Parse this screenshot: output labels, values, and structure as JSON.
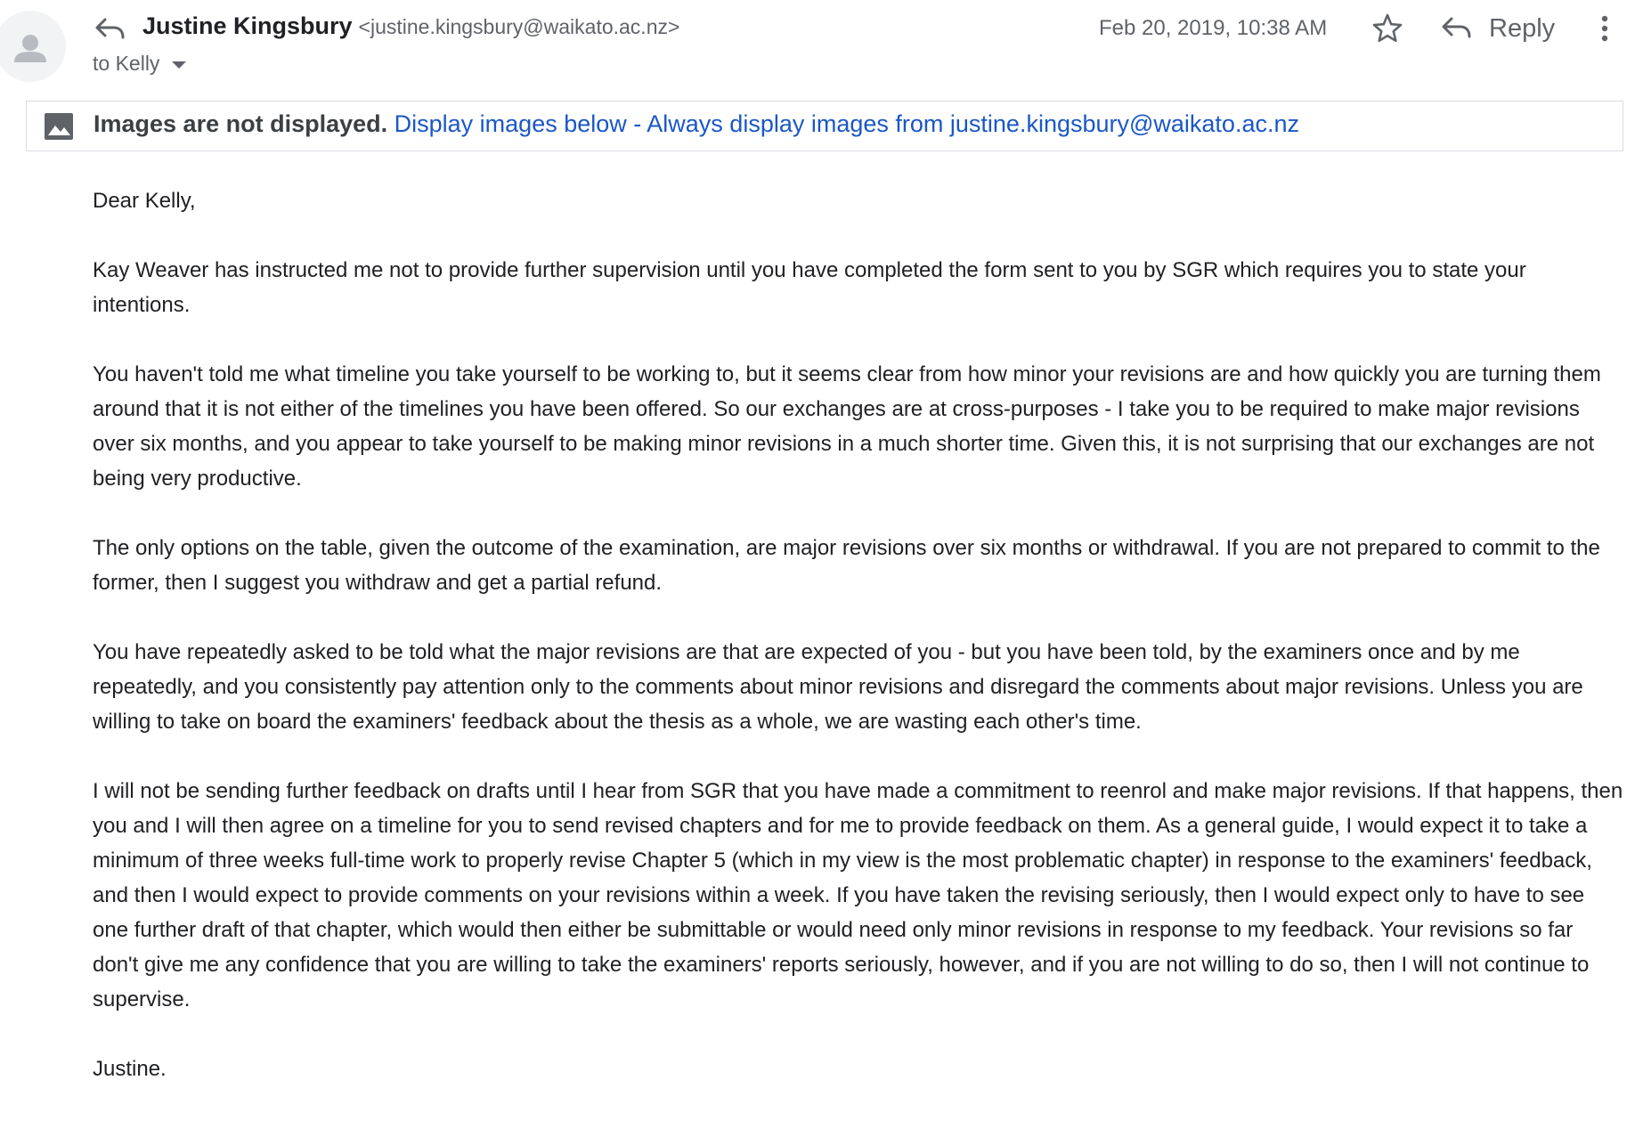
{
  "header": {
    "sender_name": "Justine Kingsbury",
    "sender_email": "<justine.kingsbury@waikato.ac.nz>",
    "recipient": "to Kelly",
    "date": "Feb 20, 2019, 10:38 AM",
    "reply_label": "Reply",
    "icons": {
      "avatar": "person-icon",
      "reply_indicator": "reply-arrow-icon",
      "star": "star-outline-icon",
      "reply": "reply-arrow-icon",
      "more": "more-vertical-icon"
    }
  },
  "images_banner": {
    "icon": "image-icon",
    "notice": "Images are not displayed.",
    "display_link": "Display images below",
    "separator": " - ",
    "always_link": "Always display images from justine.kingsbury@waikato.ac.nz"
  },
  "body": {
    "greeting": "Dear Kelly,",
    "paragraphs": [
      "Kay Weaver has instructed me not to provide further supervision until you have completed the form sent to you by SGR which requires you to state your intentions.",
      "You haven't told me what timeline you take yourself to be working to, but it seems clear from how minor your revisions are and how quickly you are turning them around that it is not either of the timelines you have been offered.  So our exchanges are at cross-purposes - I take you to be required to make major revisions over six months, and you appear to take yourself to be making minor revisions in a much shorter time. Given this, it is not surprising that our exchanges are not being very productive.",
      "The only options on the table, given the outcome of the examination, are major revisions over six months or withdrawal. If you are not prepared to commit to the former, then I suggest you withdraw and get a partial refund.",
      "You have repeatedly asked to be told what the major revisions are that are expected of you - but you have been told, by the examiners once and by me repeatedly, and you consistently pay attention only to the comments about minor revisions and disregard the comments about major revisions. Unless you are willing to take on board the examiners' feedback about the thesis as a whole, we are wasting each other's time.",
      "I will not be sending further feedback on drafts until I hear from SGR that you have made a commitment to reenrol and make major revisions. If that happens, then you and I will then agree on a timeline for you to send revised chapters and for me to provide feedback on them. As a general guide, I would expect it to take a minimum of three weeks full-time work to properly revise Chapter 5 (which in my view is the most problematic chapter) in response to the examiners' feedback, and then I would expect to provide comments on your revisions within a week. If you have taken the revising seriously, then I would expect only to have to see one further draft of that chapter, which would then either be submittable or would need only minor revisions in response to my feedback. Your revisions so far don't give me any confidence that you are willing to take the examiners' reports seriously, however, and if you are not willing to do so, then I will not continue to supervise."
    ],
    "signoff": "Justine."
  }
}
